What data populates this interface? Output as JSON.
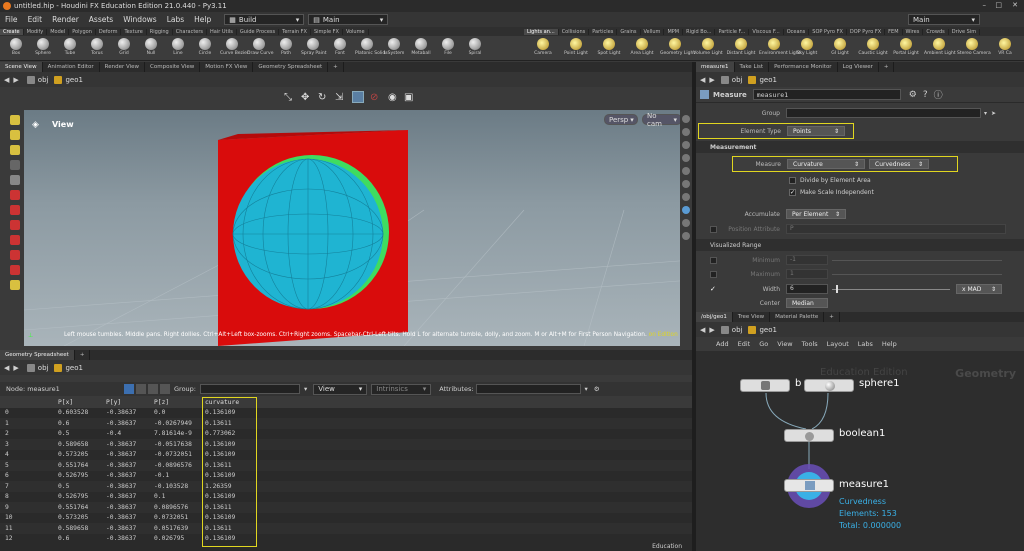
{
  "window": {
    "title": "untitled.hip - Houdini FX Education Edition 21.0.440 - Py3.11"
  },
  "menubar": {
    "items": [
      "File",
      "Edit",
      "Render",
      "Assets",
      "Windows",
      "Labs",
      "Help"
    ],
    "desktop": "Build",
    "desktop2": "Main",
    "desktop_right": "Main"
  },
  "shelf": {
    "tabs_left": [
      "Create",
      "Modify",
      "Model",
      "Polygon",
      "Deform",
      "Texture",
      "Rigging",
      "Characters",
      "Hair Utils",
      "Guide Process",
      "Terrain FX",
      "Simple FX",
      "Volume"
    ],
    "tabs_right": [
      "Lights an...",
      "Collisions",
      "Particles",
      "Grains",
      "Vellum",
      "MPM",
      "Rigid Bo...",
      "Particle F...",
      "Viscous F...",
      "Oceans",
      "SOP Pyro FX",
      "DOP Pyro FX",
      "FEM",
      "Wires",
      "Crowds",
      "Drive Sim"
    ],
    "tools_left": [
      "Box",
      "Sphere",
      "Tube",
      "Torus",
      "Grid",
      "Null",
      "Line",
      "Circle",
      "Curve Bezier",
      "Draw Curve",
      "Path",
      "Spray Paint",
      "Font",
      "Platonic Solids",
      "L-System",
      "Metaball",
      "File",
      "Spiral"
    ],
    "tools_right": [
      "Camera",
      "Point Light",
      "Spot Light",
      "Area Light",
      "Geometry Light",
      "Volume Light",
      "Distant Light",
      "Environment Light",
      "Sky Light",
      "GI Light",
      "Caustic Light",
      "Portal Light",
      "Ambient Light",
      "Stereo Camera",
      "VR Ca"
    ]
  },
  "viewer": {
    "tabs": [
      "Scene View",
      "Animation Editor",
      "Render View",
      "Composite View",
      "Motion FX View",
      "Geometry Spreadsheet"
    ],
    "path": [
      "obj",
      "geo1"
    ],
    "label": "View",
    "persp": "Persp",
    "cam": "No cam",
    "status": "Left mouse tumbles. Middle pans. Right dollies. Ctrl+Alt+Left box-zooms. Ctrl+Right zooms. Spacebar-Ctrl-Left tilts. Hold L for alternate tumble, dolly, and zoom. M or Alt+M for First Person Navigation.",
    "status_edition": "on Edition"
  },
  "spreadsheet": {
    "tab": "Geometry Spreadsheet",
    "node_label": "Node: measure1",
    "path": [
      "obj",
      "geo1"
    ],
    "group_label": "Group:",
    "view_label": "View",
    "intrinsics": "Intrinsics",
    "attributes_label": "Attributes:",
    "columns": [
      "",
      "P[x]",
      "P[y]",
      "P[z]",
      "curvature"
    ],
    "rows": [
      [
        "0",
        "0.603528",
        "-0.38637",
        "0.0",
        "0.136109"
      ],
      [
        "1",
        "0.6",
        "-0.38637",
        "-0.0267949",
        "0.13611"
      ],
      [
        "2",
        "0.5",
        "-0.4",
        "7.81614e-9",
        "0.773062"
      ],
      [
        "3",
        "0.589658",
        "-0.38637",
        "-0.0517638",
        "0.136109"
      ],
      [
        "4",
        "0.573205",
        "-0.38637",
        "-0.0732051",
        "0.136109"
      ],
      [
        "5",
        "0.551764",
        "-0.38637",
        "-0.0896576",
        "0.13611"
      ],
      [
        "6",
        "0.526795",
        "-0.38637",
        "-0.1",
        "0.136109"
      ],
      [
        "7",
        "0.5",
        "-0.38637",
        "-0.103528",
        "1.26359"
      ],
      [
        "8",
        "0.526795",
        "-0.38637",
        "0.1",
        "0.136109"
      ],
      [
        "9",
        "0.551764",
        "-0.38637",
        "0.0896576",
        "0.13611"
      ],
      [
        "10",
        "0.573205",
        "-0.38637",
        "0.0732051",
        "0.136109"
      ],
      [
        "11",
        "0.589658",
        "-0.38637",
        "0.0517639",
        "0.13611"
      ],
      [
        "12",
        "0.6",
        "-0.38637",
        "0.026795",
        "0.136109"
      ]
    ],
    "footer": "Education"
  },
  "params": {
    "tabs": [
      "measure1",
      "Take List",
      "Performance Monitor",
      "Log Viewer"
    ],
    "node_type": "Measure",
    "node_name": "measure1",
    "group_label": "Group",
    "element_type_label": "Element Type",
    "element_type": "Points",
    "measurement_header": "Measurement",
    "measure_label": "Measure",
    "measure_value": "Curvature",
    "measure_value2": "Curvedness",
    "divide_label": "Divide by Element Area",
    "scale_label": "Make Scale Independent",
    "accumulate_label": "Accumulate",
    "accumulate_value": "Per Element",
    "position_attr_label": "Position Attribute",
    "position_attr_value": "P",
    "visualized_header": "Visualized Range",
    "minimum_label": "Minimum",
    "minimum_value": "-1",
    "maximum_label": "Maximum",
    "maximum_value": "1",
    "width_label": "Width",
    "width_value": "6",
    "width_mode": "x MAD",
    "center_label": "Center",
    "center_value": "Median"
  },
  "network": {
    "tabs": [
      "/obj/geo1",
      "Tree View",
      "Material Palette"
    ],
    "path": [
      "obj",
      "geo1"
    ],
    "menu": [
      "Add",
      "Edit",
      "Go",
      "View",
      "Tools",
      "Layout",
      "Labs",
      "Help"
    ],
    "watermark": "Education Edition",
    "context": "Geometry",
    "nodes": {
      "box": "b",
      "sphere": "sphere1",
      "boolean": "boolean1",
      "measure": "measure1"
    },
    "measure_info": {
      "line1": "Curvedness",
      "line2": "Elements: 153",
      "line3": "Total: 0.000000"
    }
  },
  "colors": {
    "highlight": "#e0d620",
    "cube": "#d90c0c",
    "sphere": "#1fb4d2",
    "node_blue": "#3ab0e6"
  }
}
